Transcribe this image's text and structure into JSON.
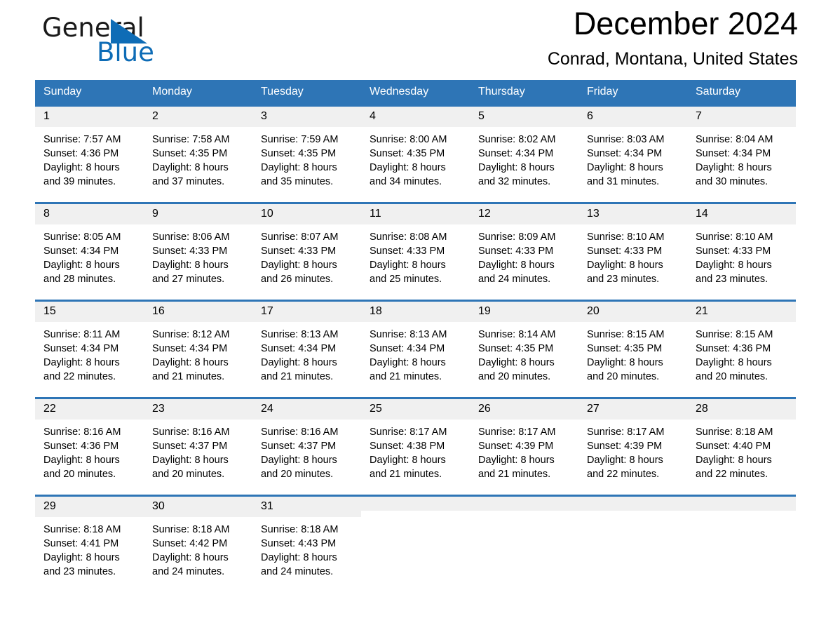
{
  "logo": {
    "word_one": "General",
    "word_two": "Blue",
    "triangle_color": "#0e6cb6"
  },
  "header": {
    "title": "December 2024",
    "location": "Conrad, Montana, United States"
  },
  "theme": {
    "header_blue": "#2e75b6",
    "daynum_band": "#f0f0f0",
    "text": "#000000",
    "logo_blue": "#0e6cb6"
  },
  "weekday_headers": [
    "Sunday",
    "Monday",
    "Tuesday",
    "Wednesday",
    "Thursday",
    "Friday",
    "Saturday"
  ],
  "weeks": [
    [
      {
        "day": "1",
        "sunrise": "Sunrise: 7:57 AM",
        "sunset": "Sunset: 4:36 PM",
        "daylight_line1": "Daylight: 8 hours",
        "daylight_line2": "and 39 minutes."
      },
      {
        "day": "2",
        "sunrise": "Sunrise: 7:58 AM",
        "sunset": "Sunset: 4:35 PM",
        "daylight_line1": "Daylight: 8 hours",
        "daylight_line2": "and 37 minutes."
      },
      {
        "day": "3",
        "sunrise": "Sunrise: 7:59 AM",
        "sunset": "Sunset: 4:35 PM",
        "daylight_line1": "Daylight: 8 hours",
        "daylight_line2": "and 35 minutes."
      },
      {
        "day": "4",
        "sunrise": "Sunrise: 8:00 AM",
        "sunset": "Sunset: 4:35 PM",
        "daylight_line1": "Daylight: 8 hours",
        "daylight_line2": "and 34 minutes."
      },
      {
        "day": "5",
        "sunrise": "Sunrise: 8:02 AM",
        "sunset": "Sunset: 4:34 PM",
        "daylight_line1": "Daylight: 8 hours",
        "daylight_line2": "and 32 minutes."
      },
      {
        "day": "6",
        "sunrise": "Sunrise: 8:03 AM",
        "sunset": "Sunset: 4:34 PM",
        "daylight_line1": "Daylight: 8 hours",
        "daylight_line2": "and 31 minutes."
      },
      {
        "day": "7",
        "sunrise": "Sunrise: 8:04 AM",
        "sunset": "Sunset: 4:34 PM",
        "daylight_line1": "Daylight: 8 hours",
        "daylight_line2": "and 30 minutes."
      }
    ],
    [
      {
        "day": "8",
        "sunrise": "Sunrise: 8:05 AM",
        "sunset": "Sunset: 4:34 PM",
        "daylight_line1": "Daylight: 8 hours",
        "daylight_line2": "and 28 minutes."
      },
      {
        "day": "9",
        "sunrise": "Sunrise: 8:06 AM",
        "sunset": "Sunset: 4:33 PM",
        "daylight_line1": "Daylight: 8 hours",
        "daylight_line2": "and 27 minutes."
      },
      {
        "day": "10",
        "sunrise": "Sunrise: 8:07 AM",
        "sunset": "Sunset: 4:33 PM",
        "daylight_line1": "Daylight: 8 hours",
        "daylight_line2": "and 26 minutes."
      },
      {
        "day": "11",
        "sunrise": "Sunrise: 8:08 AM",
        "sunset": "Sunset: 4:33 PM",
        "daylight_line1": "Daylight: 8 hours",
        "daylight_line2": "and 25 minutes."
      },
      {
        "day": "12",
        "sunrise": "Sunrise: 8:09 AM",
        "sunset": "Sunset: 4:33 PM",
        "daylight_line1": "Daylight: 8 hours",
        "daylight_line2": "and 24 minutes."
      },
      {
        "day": "13",
        "sunrise": "Sunrise: 8:10 AM",
        "sunset": "Sunset: 4:33 PM",
        "daylight_line1": "Daylight: 8 hours",
        "daylight_line2": "and 23 minutes."
      },
      {
        "day": "14",
        "sunrise": "Sunrise: 8:10 AM",
        "sunset": "Sunset: 4:33 PM",
        "daylight_line1": "Daylight: 8 hours",
        "daylight_line2": "and 23 minutes."
      }
    ],
    [
      {
        "day": "15",
        "sunrise": "Sunrise: 8:11 AM",
        "sunset": "Sunset: 4:34 PM",
        "daylight_line1": "Daylight: 8 hours",
        "daylight_line2": "and 22 minutes."
      },
      {
        "day": "16",
        "sunrise": "Sunrise: 8:12 AM",
        "sunset": "Sunset: 4:34 PM",
        "daylight_line1": "Daylight: 8 hours",
        "daylight_line2": "and 21 minutes."
      },
      {
        "day": "17",
        "sunrise": "Sunrise: 8:13 AM",
        "sunset": "Sunset: 4:34 PM",
        "daylight_line1": "Daylight: 8 hours",
        "daylight_line2": "and 21 minutes."
      },
      {
        "day": "18",
        "sunrise": "Sunrise: 8:13 AM",
        "sunset": "Sunset: 4:34 PM",
        "daylight_line1": "Daylight: 8 hours",
        "daylight_line2": "and 21 minutes."
      },
      {
        "day": "19",
        "sunrise": "Sunrise: 8:14 AM",
        "sunset": "Sunset: 4:35 PM",
        "daylight_line1": "Daylight: 8 hours",
        "daylight_line2": "and 20 minutes."
      },
      {
        "day": "20",
        "sunrise": "Sunrise: 8:15 AM",
        "sunset": "Sunset: 4:35 PM",
        "daylight_line1": "Daylight: 8 hours",
        "daylight_line2": "and 20 minutes."
      },
      {
        "day": "21",
        "sunrise": "Sunrise: 8:15 AM",
        "sunset": "Sunset: 4:36 PM",
        "daylight_line1": "Daylight: 8 hours",
        "daylight_line2": "and 20 minutes."
      }
    ],
    [
      {
        "day": "22",
        "sunrise": "Sunrise: 8:16 AM",
        "sunset": "Sunset: 4:36 PM",
        "daylight_line1": "Daylight: 8 hours",
        "daylight_line2": "and 20 minutes."
      },
      {
        "day": "23",
        "sunrise": "Sunrise: 8:16 AM",
        "sunset": "Sunset: 4:37 PM",
        "daylight_line1": "Daylight: 8 hours",
        "daylight_line2": "and 20 minutes."
      },
      {
        "day": "24",
        "sunrise": "Sunrise: 8:16 AM",
        "sunset": "Sunset: 4:37 PM",
        "daylight_line1": "Daylight: 8 hours",
        "daylight_line2": "and 20 minutes."
      },
      {
        "day": "25",
        "sunrise": "Sunrise: 8:17 AM",
        "sunset": "Sunset: 4:38 PM",
        "daylight_line1": "Daylight: 8 hours",
        "daylight_line2": "and 21 minutes."
      },
      {
        "day": "26",
        "sunrise": "Sunrise: 8:17 AM",
        "sunset": "Sunset: 4:39 PM",
        "daylight_line1": "Daylight: 8 hours",
        "daylight_line2": "and 21 minutes."
      },
      {
        "day": "27",
        "sunrise": "Sunrise: 8:17 AM",
        "sunset": "Sunset: 4:39 PM",
        "daylight_line1": "Daylight: 8 hours",
        "daylight_line2": "and 22 minutes."
      },
      {
        "day": "28",
        "sunrise": "Sunrise: 8:18 AM",
        "sunset": "Sunset: 4:40 PM",
        "daylight_line1": "Daylight: 8 hours",
        "daylight_line2": "and 22 minutes."
      }
    ],
    [
      {
        "day": "29",
        "sunrise": "Sunrise: 8:18 AM",
        "sunset": "Sunset: 4:41 PM",
        "daylight_line1": "Daylight: 8 hours",
        "daylight_line2": "and 23 minutes."
      },
      {
        "day": "30",
        "sunrise": "Sunrise: 8:18 AM",
        "sunset": "Sunset: 4:42 PM",
        "daylight_line1": "Daylight: 8 hours",
        "daylight_line2": "and 24 minutes."
      },
      {
        "day": "31",
        "sunrise": "Sunrise: 8:18 AM",
        "sunset": "Sunset: 4:43 PM",
        "daylight_line1": "Daylight: 8 hours",
        "daylight_line2": "and 24 minutes."
      },
      {
        "day": "",
        "sunrise": "",
        "sunset": "",
        "daylight_line1": "",
        "daylight_line2": ""
      },
      {
        "day": "",
        "sunrise": "",
        "sunset": "",
        "daylight_line1": "",
        "daylight_line2": ""
      },
      {
        "day": "",
        "sunrise": "",
        "sunset": "",
        "daylight_line1": "",
        "daylight_line2": ""
      },
      {
        "day": "",
        "sunrise": "",
        "sunset": "",
        "daylight_line1": "",
        "daylight_line2": ""
      }
    ]
  ]
}
